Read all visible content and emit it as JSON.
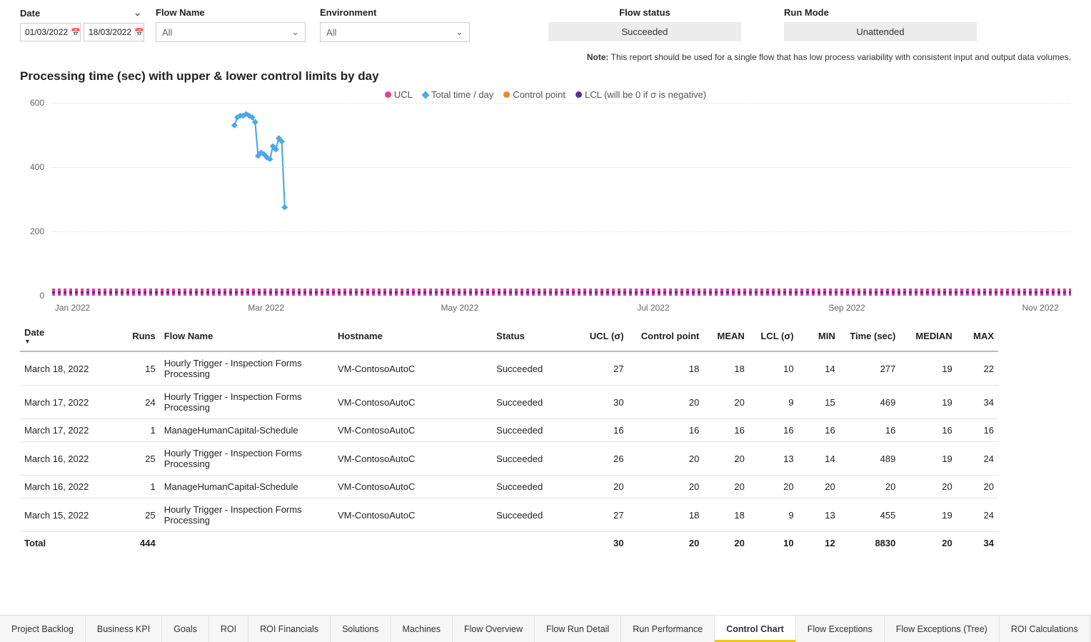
{
  "filters": {
    "date_label": "Date",
    "date_from": "01/03/2022",
    "date_to": "18/03/2022",
    "flow_name_label": "Flow Name",
    "flow_name_value": "All",
    "environment_label": "Environment",
    "environment_value": "All",
    "flow_status_label": "Flow status",
    "flow_status_value": "Succeeded",
    "run_mode_label": "Run Mode",
    "run_mode_value": "Unattended"
  },
  "note_label": "Note:",
  "note_text": "This report should be used for a single flow that has low process variability with consistent input and output data volumes.",
  "chart_title": "Processing time (sec) with upper & lower control limits by day",
  "legend": {
    "ucl": "UCL",
    "total": "Total time / day",
    "cp": "Control point",
    "lcl": "LCL (will be 0 if σ is negative)"
  },
  "chart_data": {
    "type": "line",
    "title": "Processing time (sec) with upper & lower control limits by day",
    "xlabel": "",
    "ylabel": "",
    "ylim": [
      0,
      600
    ],
    "y_ticks": [
      0,
      200,
      400,
      600
    ],
    "x_ticks": [
      "Jan 2022",
      "Mar 2022",
      "May 2022",
      "Jul 2022",
      "Sep 2022",
      "Nov 2022"
    ],
    "series": [
      {
        "name": "Total time / day",
        "color": "#4fa7e6",
        "x": [
          "2022-03-01",
          "2022-03-02",
          "2022-03-03",
          "2022-03-04",
          "2022-03-05",
          "2022-03-06",
          "2022-03-07",
          "2022-03-08",
          "2022-03-09",
          "2022-03-10",
          "2022-03-11",
          "2022-03-12",
          "2022-03-13",
          "2022-03-14",
          "2022-03-15",
          "2022-03-16",
          "2022-03-17",
          "2022-03-18"
        ],
        "values": [
          530,
          555,
          560,
          560,
          565,
          560,
          555,
          540,
          435,
          445,
          440,
          430,
          425,
          465,
          455,
          490,
          480,
          275
        ]
      },
      {
        "name": "UCL",
        "color": "#e63e96",
        "x": [],
        "values": []
      },
      {
        "name": "Control point",
        "color": "#e68a2e",
        "x": [],
        "values": []
      },
      {
        "name": "LCL (will be 0 if σ is negative)",
        "color": "#5b2d90",
        "x": [],
        "values": []
      }
    ]
  },
  "table": {
    "columns": [
      "Date",
      "Runs",
      "Flow Name",
      "Hostname",
      "Status",
      "UCL (σ)",
      "Control point",
      "MEAN",
      "LCL (σ)",
      "MIN",
      "Time (sec)",
      "MEDIAN",
      "MAX"
    ],
    "rows": [
      {
        "date": "March 18, 2022",
        "runs": 15,
        "flow": "Hourly Trigger - Inspection Forms Processing",
        "host": "VM-ContosoAutoC",
        "status": "Succeeded",
        "ucl": 27,
        "cp": 18,
        "mean": 18,
        "lcl": 10,
        "min": 14,
        "time": 277,
        "median": 19,
        "max": 22
      },
      {
        "date": "March 17, 2022",
        "runs": 24,
        "flow": "Hourly Trigger - Inspection Forms Processing",
        "host": "VM-ContosoAutoC",
        "status": "Succeeded",
        "ucl": 30,
        "cp": 20,
        "mean": 20,
        "lcl": 9,
        "min": 15,
        "time": 469,
        "median": 19,
        "max": 34
      },
      {
        "date": "March 17, 2022",
        "runs": 1,
        "flow": "ManageHumanCapital-Schedule",
        "host": "VM-ContosoAutoC",
        "status": "Succeeded",
        "ucl": 16,
        "cp": 16,
        "mean": 16,
        "lcl": 16,
        "min": 16,
        "time": 16,
        "median": 16,
        "max": 16
      },
      {
        "date": "March 16, 2022",
        "runs": 25,
        "flow": "Hourly Trigger - Inspection Forms Processing",
        "host": "VM-ContosoAutoC",
        "status": "Succeeded",
        "ucl": 26,
        "cp": 20,
        "mean": 20,
        "lcl": 13,
        "min": 14,
        "time": 489,
        "median": 19,
        "max": 24
      },
      {
        "date": "March 16, 2022",
        "runs": 1,
        "flow": "ManageHumanCapital-Schedule",
        "host": "VM-ContosoAutoC",
        "status": "Succeeded",
        "ucl": 20,
        "cp": 20,
        "mean": 20,
        "lcl": 20,
        "min": 20,
        "time": 20,
        "median": 20,
        "max": 20
      },
      {
        "date": "March 15, 2022",
        "runs": 25,
        "flow": "Hourly Trigger - Inspection Forms Processing",
        "host": "VM-ContosoAutoC",
        "status": "Succeeded",
        "ucl": 27,
        "cp": 18,
        "mean": 18,
        "lcl": 9,
        "min": 13,
        "time": 455,
        "median": 19,
        "max": 24
      }
    ],
    "total": {
      "label": "Total",
      "runs": 444,
      "ucl": 30,
      "cp": 20,
      "mean": 20,
      "lcl": 10,
      "min": 12,
      "time": 8830,
      "median": 20,
      "max": 34
    }
  },
  "tabs": [
    "Project Backlog",
    "Business KPI",
    "Goals",
    "ROI",
    "ROI Financials",
    "Solutions",
    "Machines",
    "Flow Overview",
    "Flow Run Detail",
    "Run Performance",
    "Control Chart",
    "Flow Exceptions",
    "Flow Exceptions (Tree)",
    "ROI Calculations"
  ],
  "active_tab": "Control Chart"
}
